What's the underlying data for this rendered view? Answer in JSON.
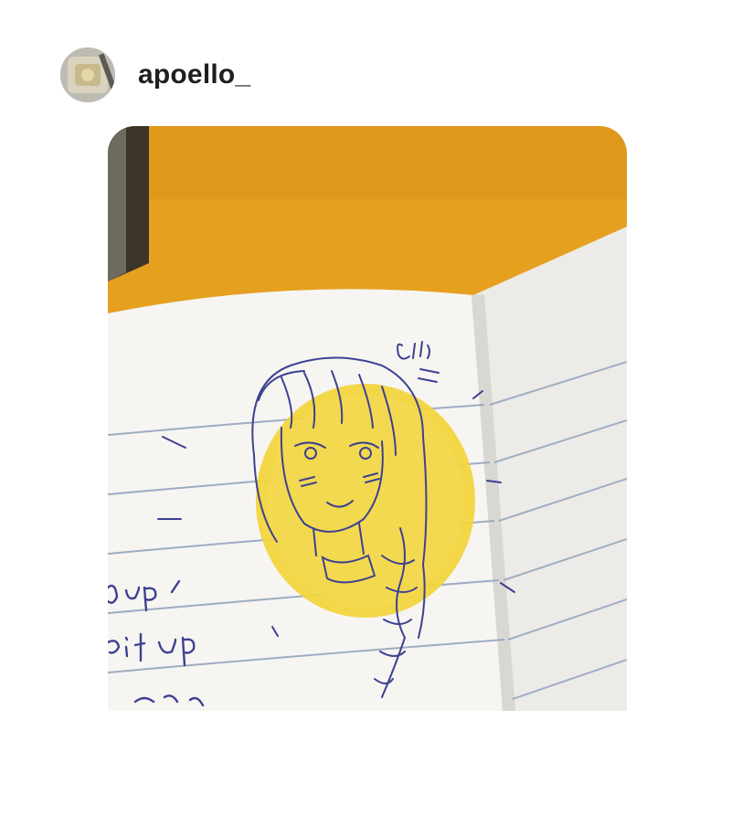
{
  "post": {
    "username": "apoello_",
    "avatar_icon": "profile-photo-icon",
    "image_icon": "sketch-photo-icon"
  },
  "colors": {
    "desk_orange": "#e7a11f",
    "page_paper": "#f5f4f1",
    "ruled_line": "#8f9fb8",
    "ink_blue": "#3a3e8f",
    "highlighter_yellow": "#f2d53c"
  },
  "image": {
    "handwritten_lines": [
      "up",
      "e.t up"
    ]
  }
}
